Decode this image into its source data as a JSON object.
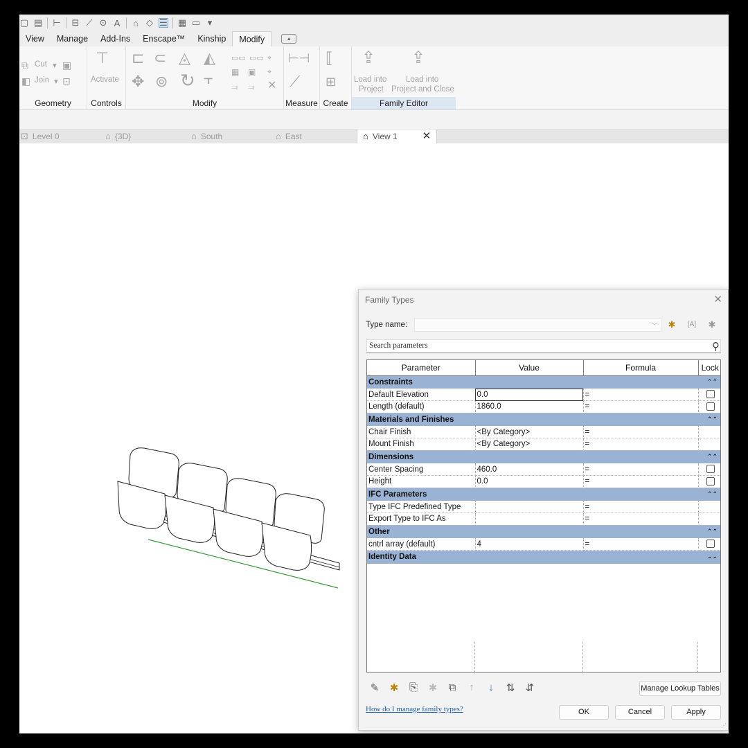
{
  "ribbon": {
    "tabs": [
      "View",
      "Manage",
      "Add-Ins",
      "Enscape™",
      "Kinship",
      "Modify"
    ],
    "active_tab": "Modify",
    "geometry": {
      "cut": "Cut",
      "join": "Join",
      "label": "Geometry"
    },
    "controls": {
      "activate": "Activate",
      "label": "Controls"
    },
    "modify_label": "Modify",
    "measure_label": "Measure",
    "create_label": "Create",
    "family_editor": {
      "load_project_1": "Load into",
      "load_project_2": "Project",
      "load_close_1": "Load into",
      "load_close_2": "Project and Close",
      "label": "Family Editor"
    }
  },
  "view_tabs": [
    "Level 0",
    "{3D}",
    "South",
    "East",
    "View 1"
  ],
  "dialog": {
    "title": "Family Types",
    "type_name_label": "Type name:",
    "type_name_value": "",
    "search_placeholder": "Search parameters",
    "headers": {
      "parameter": "Parameter",
      "value": "Value",
      "formula": "Formula",
      "lock": "Lock"
    },
    "groups": {
      "constraints": "Constraints",
      "materials": "Materials and Finishes",
      "dimensions": "Dimensions",
      "ifc": "IFC Parameters",
      "other": "Other",
      "identity": "Identity Data"
    },
    "rows": {
      "default_elevation": {
        "name": "Default Elevation",
        "value": "0.0",
        "formula": "="
      },
      "length": {
        "name": "Length (default)",
        "value": "1860.0",
        "formula": "="
      },
      "chair_finish": {
        "name": "Chair Finish",
        "value": "<By Category>",
        "formula": "="
      },
      "mount_finish": {
        "name": "Mount Finish",
        "value": "<By Category>",
        "formula": "="
      },
      "center_spacing": {
        "name": "Center Spacing",
        "value": "460.0",
        "formula": "="
      },
      "height": {
        "name": "Height",
        "value": "0.0",
        "formula": "="
      },
      "ifc_type": {
        "name": "Type IFC Predefined Type",
        "value": "",
        "formula": "="
      },
      "export_type": {
        "name": "Export Type to IFC As",
        "value": "",
        "formula": "="
      },
      "cntrl_array": {
        "name": "cntrl array (default)",
        "value": "4",
        "formula": "="
      }
    },
    "manage_lookup": "Manage Lookup Tables",
    "help_link": "How do I manage family types?",
    "ok": "OK",
    "cancel": "Cancel",
    "apply": "Apply"
  },
  "colors": {
    "group_header": "#9ab3d5",
    "link": "#1a5fb4",
    "accent": "#2b79d0"
  }
}
